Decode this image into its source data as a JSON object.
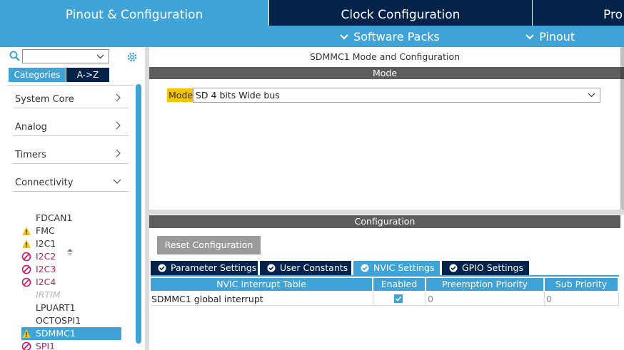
{
  "top_tabs": {
    "pinout": "Pinout & Configuration",
    "clock": "Clock Configuration",
    "project": "Pro"
  },
  "subbar": {
    "software_packs": "Software Packs",
    "pinout": "Pinout"
  },
  "left": {
    "tabs": {
      "categories": "Categories",
      "az": "A->Z"
    },
    "groups": [
      {
        "label": "System Core",
        "expanded": false
      },
      {
        "label": "Analog",
        "expanded": false
      },
      {
        "label": "Timers",
        "expanded": false
      },
      {
        "label": "Connectivity",
        "expanded": true
      }
    ],
    "peripherals": [
      {
        "label": "FDCAN1",
        "status": "none"
      },
      {
        "label": "FMC",
        "status": "warning"
      },
      {
        "label": "I2C1",
        "status": "warning"
      },
      {
        "label": "I2C2",
        "status": "error"
      },
      {
        "label": "I2C3",
        "status": "error"
      },
      {
        "label": "I2C4",
        "status": "error"
      },
      {
        "label": "IRTIM",
        "status": "disabled"
      },
      {
        "label": "LPUART1",
        "status": "none"
      },
      {
        "label": "OCTOSPI1",
        "status": "none"
      },
      {
        "label": "SDMMC1",
        "status": "warning-selected"
      },
      {
        "label": "SPI1",
        "status": "error"
      }
    ]
  },
  "right": {
    "mode_title": "SDMMC1 Mode and Configuration",
    "mode_header": "Mode",
    "mode_label": "Mode",
    "mode_value": "SD 4 bits Wide bus",
    "config_header": "Configuration",
    "reset_button": "Reset Configuration",
    "config_tabs": [
      {
        "label": "Parameter Settings",
        "active": false
      },
      {
        "label": "User Constants",
        "active": false
      },
      {
        "label": "NVIC Settings",
        "active": true
      },
      {
        "label": "GPIO Settings",
        "active": false
      }
    ],
    "nvic_table": {
      "headers": [
        "NVIC Interrupt Table",
        "Enabled",
        "Preemption Priority",
        "Sub Priority"
      ],
      "rows": [
        {
          "name": "SDMMC1 global interrupt",
          "enabled": true,
          "preemption": "0",
          "sub": "0"
        }
      ]
    }
  },
  "colors": {
    "accent": "#3fa3d8",
    "navy": "#03234b",
    "header_gray": "#5d5d5d",
    "warning": "#f5c400",
    "error": "#d4116a"
  }
}
